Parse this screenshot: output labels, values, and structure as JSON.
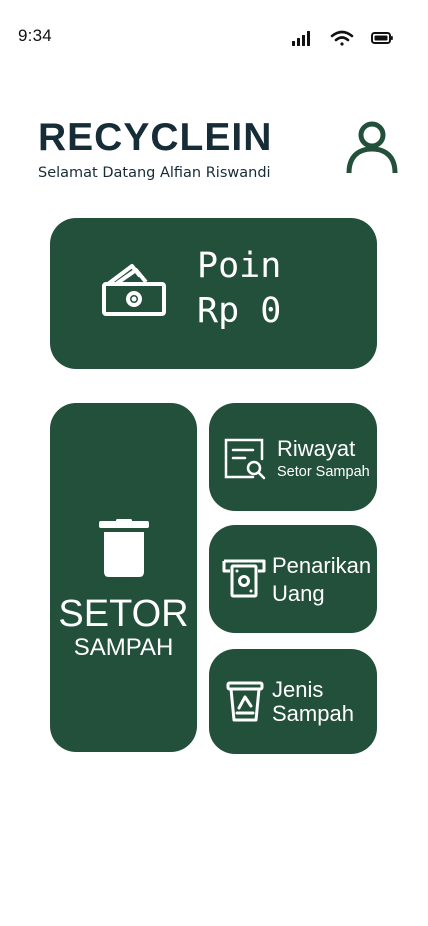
{
  "status_bar": {
    "time": "9:34",
    "icons": [
      "signal-icon",
      "wifi-icon",
      "battery-icon"
    ]
  },
  "header": {
    "app_title": "RECYCLEIN",
    "welcome_text": "Selamat Datang Alfian Riswandi",
    "profile_icon": "user-icon"
  },
  "points_card": {
    "icon": "money-icon",
    "label": "Poin",
    "value": "Rp 0"
  },
  "menu": {
    "setor": {
      "icon": "trash-icon",
      "title": "SETOR",
      "subtitle": "SAMPAH"
    },
    "riwayat": {
      "icon": "document-search-icon",
      "title": "Riwayat",
      "subtitle": "Setor Sampah"
    },
    "penarikan": {
      "icon": "atm-withdraw-icon",
      "line1": "Penarikan",
      "line2": "Uang"
    },
    "jenis": {
      "icon": "recycle-bin-icon",
      "line1": "Jenis",
      "line2": "Sampah"
    }
  },
  "colors": {
    "primary": "#23503b",
    "title": "#162c36",
    "background": "#ffffff"
  }
}
